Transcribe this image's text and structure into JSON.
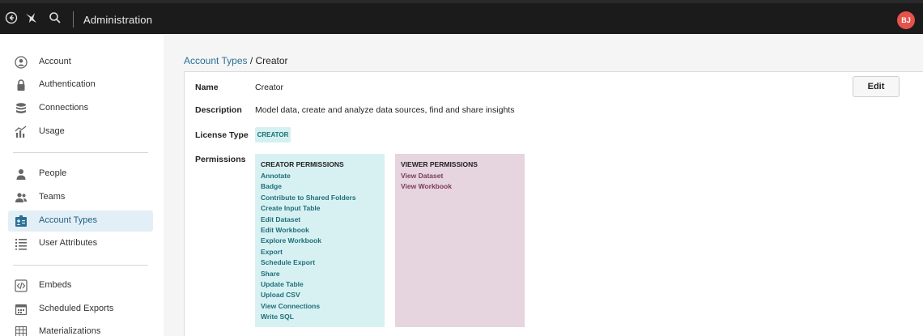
{
  "header": {
    "title": "Administration",
    "avatar_initials": "BJ",
    "icons": [
      "back-icon",
      "logo-icon",
      "search-icon"
    ]
  },
  "sidebar": {
    "groups": [
      [
        {
          "label": "Account",
          "icon": "user-circle-icon"
        },
        {
          "label": "Authentication",
          "icon": "lock-icon"
        },
        {
          "label": "Connections",
          "icon": "database-icon"
        },
        {
          "label": "Usage",
          "icon": "usage-chart-icon"
        }
      ],
      [
        {
          "label": "People",
          "icon": "person-icon"
        },
        {
          "label": "Teams",
          "icon": "team-icon"
        },
        {
          "label": "Account Types",
          "icon": "id-badge-icon",
          "active": true
        },
        {
          "label": "User Attributes",
          "icon": "list-icon"
        }
      ],
      [
        {
          "label": "Embeds",
          "icon": "code-icon"
        },
        {
          "label": "Scheduled Exports",
          "icon": "calendar-icon"
        },
        {
          "label": "Materializations",
          "icon": "table-icon"
        }
      ]
    ]
  },
  "breadcrumb": {
    "parent": "Account Types",
    "separator": " / ",
    "current": "Creator"
  },
  "detail": {
    "edit_label": "Edit",
    "name_label": "Name",
    "name_value": "Creator",
    "description_label": "Description",
    "description_value": "Model data, create and analyze data sources, find and share insights",
    "license_label": "License Type",
    "license_value": "CREATOR",
    "permissions_label": "Permissions"
  },
  "permissions": {
    "creator": {
      "title": "CREATOR PERMISSIONS",
      "items": [
        "Annotate",
        "Badge",
        "Contribute to Shared Folders",
        "Create Input Table",
        "Edit Dataset",
        "Edit Workbook",
        "Explore Workbook",
        "Export",
        "Schedule Export",
        "Share",
        "Update Table",
        "Upload CSV",
        "View Connections",
        "Write SQL"
      ]
    },
    "viewer": {
      "title": "VIEWER PERMISSIONS",
      "items": [
        "View Dataset",
        "View Workbook"
      ]
    }
  },
  "colors": {
    "topbar": "#1b1b1b",
    "accent_link": "#2b6f96",
    "creator_bg": "#d7f1f2",
    "viewer_bg": "#e6d4df",
    "avatar": "#e5534b"
  }
}
